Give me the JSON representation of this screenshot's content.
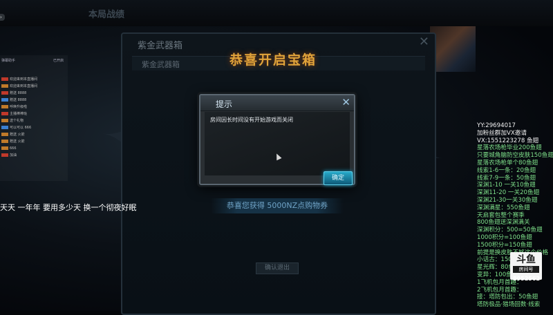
{
  "game": {
    "top_label": "本局战绩",
    "bg_panel_title": "紫金武器箱",
    "bg_panel_sub_title": "紫金武器箱",
    "banner": "恭喜开启宝箱",
    "congrats": "恭喜您获得 5000NZ点购物券",
    "confirm_exit": "确认退出"
  },
  "dialog": {
    "title": "提示",
    "message": "房间因长时间没有开始游戏而关闭",
    "close_glyph": "✕",
    "ok_label": "确定"
  },
  "chat": {
    "header_left": "弹幕助手",
    "header_right": "已开启",
    "rows": [
      "欢迎来到本直播间",
      "欢迎来到本直播间",
      "赠送 8888",
      "赠送 8888",
      "呼唤升级啦",
      "主播棒棒哒",
      "送个礼物",
      "可以可以 666",
      "赠送 火箭",
      "赠送 火箭",
      "666",
      "加油"
    ]
  },
  "ticker": "天天 一年年 要用多少天 换一个彻夜好眠",
  "streamer_info": {
    "lines": [
      {
        "text": "YY:29694017",
        "color": "w"
      },
      {
        "text": "加粉丝群加VX邀请",
        "color": "w"
      },
      {
        "text": "VX:1551223278 鱼翅",
        "color": "w"
      },
      {
        "text": "星落农场枪毕业200鱼翅",
        "color": "g"
      },
      {
        "text": "只要城角脑防空皮肤150鱼翅",
        "color": "g"
      },
      {
        "text": "星落农场枪单个80鱼翅",
        "color": "g"
      },
      {
        "text": "线索1-6一条：20鱼翅",
        "color": "g"
      },
      {
        "text": "线索7-9一条：50鱼翅",
        "color": "g"
      },
      {
        "text": "深渊1-10 一关10鱼翅",
        "color": "g"
      },
      {
        "text": "深渊11-20 一关20鱼翅",
        "color": "g"
      },
      {
        "text": "深渊21-30一关30鱼翅",
        "color": "g"
      },
      {
        "text": "深渊满星：550鱼翅",
        "color": "g"
      },
      {
        "text": "天启套包整个赛季",
        "color": "g"
      },
      {
        "text": "800鱼翅送深渊满关",
        "color": "g"
      },
      {
        "text": "深渊积分：500=50鱼翅",
        "color": "g"
      },
      {
        "text": "1000积分=100鱼翅",
        "color": "g"
      },
      {
        "text": "1500积分=150鱼翅",
        "color": "g"
      },
      {
        "text": "前提是换皮肤不够这个价格",
        "color": "g"
      },
      {
        "text": "小话古：150鱼翅",
        "color": "g"
      },
      {
        "text": "星光辉：80鱼翅",
        "color": "g"
      },
      {
        "text": "变异：100鱼翅",
        "color": "g"
      },
      {
        "text": "1飞机包月首趣：",
        "color": "g"
      },
      {
        "text": "2飞机包月首趣：",
        "color": "g"
      },
      {
        "text": "接：塔防包出：50鱼翅",
        "color": "g"
      },
      {
        "text": "塔防极品·猎场回数·线索",
        "color": "g"
      }
    ]
  },
  "logo": {
    "title": "斗鱼",
    "sub": "房间号",
    "room_number": "8952562"
  }
}
